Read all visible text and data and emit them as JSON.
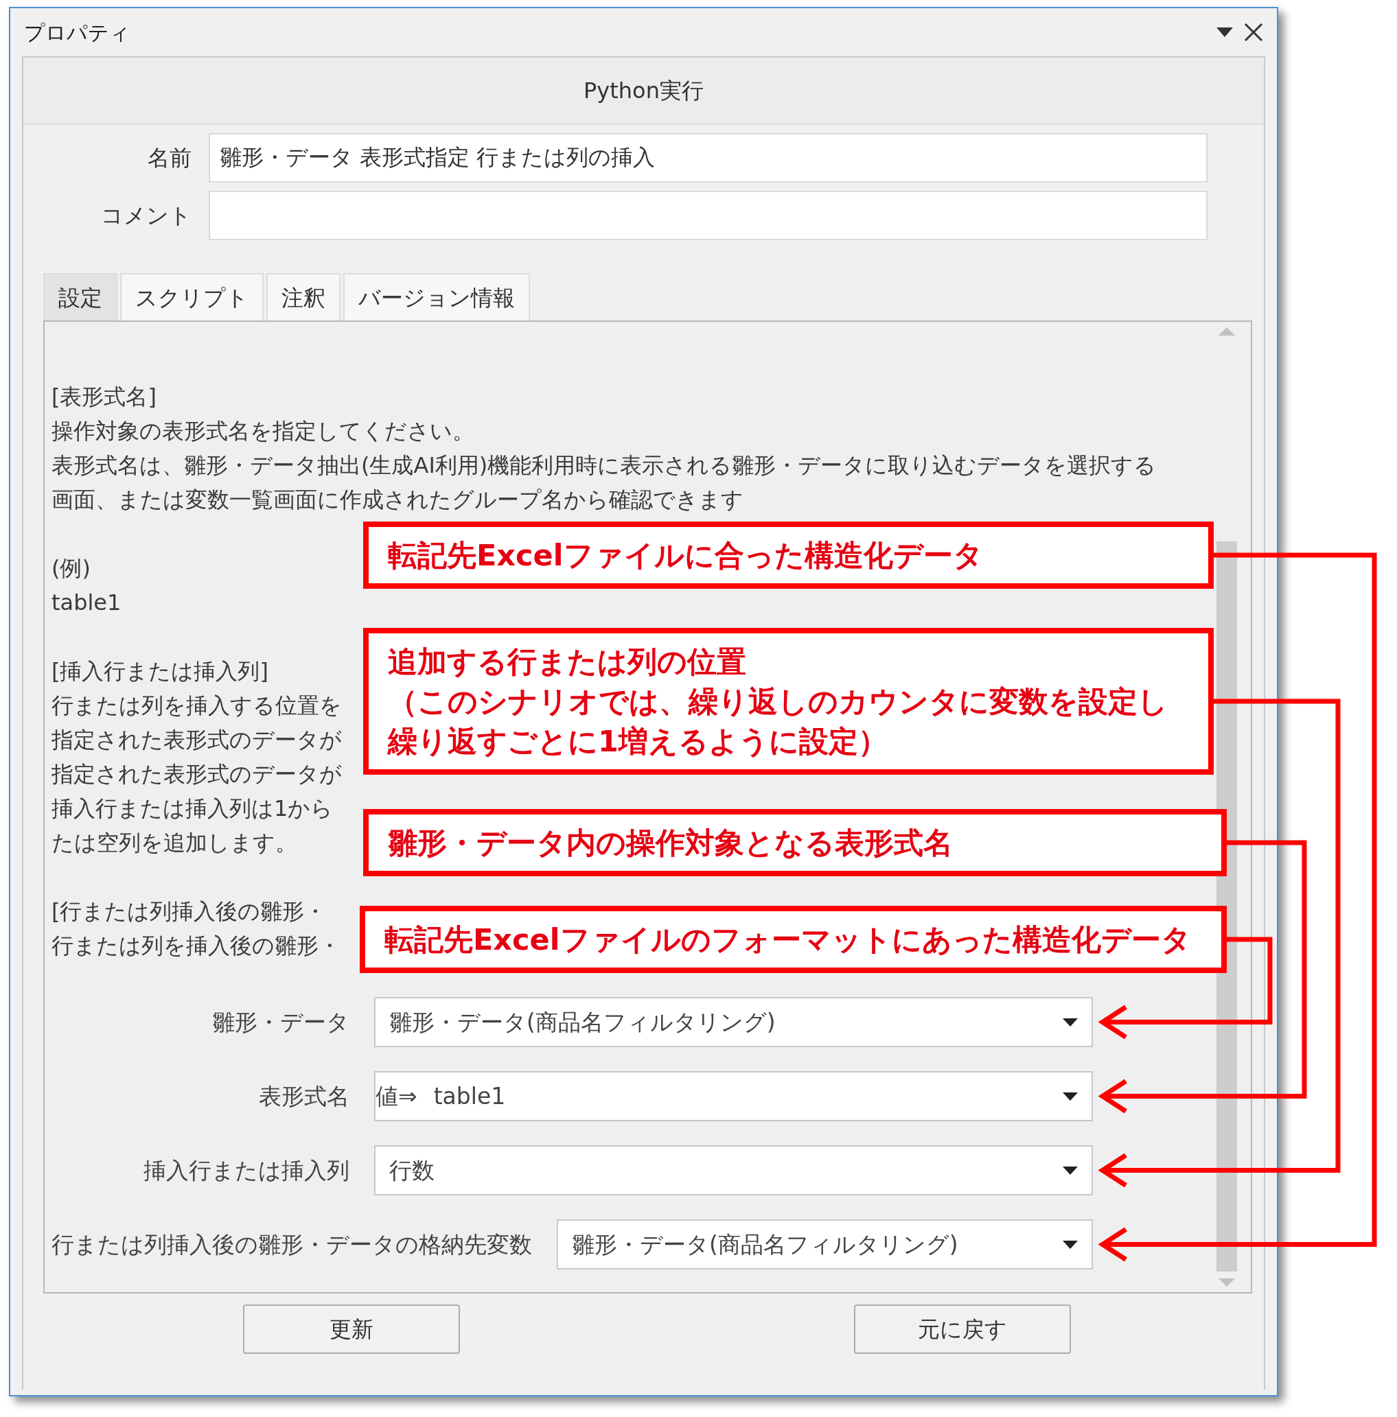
{
  "window": {
    "title": "プロパティ"
  },
  "header": {
    "title": "Python実行"
  },
  "fields": [
    {
      "label": "名前",
      "value": "雛形・データ 表形式指定 行または列の挿入"
    },
    {
      "label": "コメント"
    }
  ],
  "tabs": [
    {
      "label": "設定",
      "selected": true
    },
    {
      "label": "スクリプト",
      "selected": false
    },
    {
      "label": "注釈",
      "selected": false
    },
    {
      "label": "バージョン情報",
      "selected": false
    }
  ],
  "description": [
    [
      "[表形式名]",
      "操作対象の表形式名を指定してください。",
      "表形式名は、雛形・データ抽出(生成AI利用)機能利用時に表示される雛形・データに取り込むデータを選択する",
      "画面、または変数一覧画面に作成されたグループ名から確認できます"
    ],
    [
      "(例)",
      "table1"
    ],
    [
      "[挿入行または挿入列]",
      "行または列を挿入する位置を",
      "指定された表形式のデータが",
      "指定された表形式のデータが",
      "挿入行または挿入列は1から",
      "たは空列を追加します。"
    ],
    [
      "[行または列挿入後の雛形・",
      "行または列を挿入後の雛形・"
    ]
  ],
  "settings": [
    {
      "label": "雛形・データ",
      "value": "雛形・データ(商品名フィルタリング)"
    },
    {
      "label": "表形式名",
      "prefix": "値⇒",
      "value": "table1"
    },
    {
      "label": "挿入行または挿入列",
      "value": "行数"
    },
    {
      "label": "行または列挿入後の雛形・データの格納先変数",
      "value": "雛形・データ(商品名フィルタリング)"
    }
  ],
  "buttons": [
    "更新",
    "元に戻す"
  ],
  "callouts": [
    {
      "lines": [
        "転記先Excelファイルに合った構造化データ"
      ],
      "kind": "callout"
    },
    {
      "lines": [
        "追加する行または列の位置",
        "（このシナリオでは、繰り返しのカウンタに変数を設定し繰り返すごとに1増えるように設定）"
      ],
      "kind": "callout"
    },
    {
      "lines": [
        "雛形・データ内の操作対象となる表形式名"
      ],
      "kind": "callout"
    },
    {
      "lines": [
        "転記先Excelファイルのフォーマットにあった構造化データ"
      ],
      "kind": "callout"
    }
  ]
}
